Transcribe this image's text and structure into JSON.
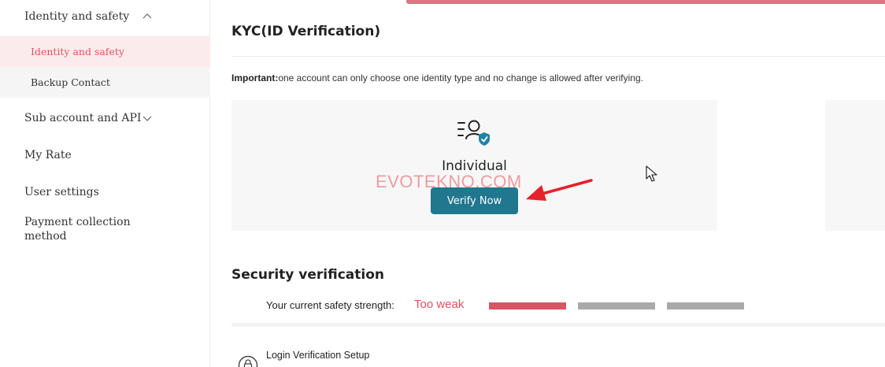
{
  "sidebar": {
    "group_identity": "Identity and safety",
    "sub_items": [
      "Identity and safety",
      "Backup Contact"
    ],
    "group_sub_account": "Sub account and API",
    "my_rate": "My Rate",
    "user_settings": "User settings",
    "payment_collection": "Payment collection method"
  },
  "kyc": {
    "title": "KYC(ID Verification)",
    "important_label": "Important:",
    "important_text": "one account can only choose one identity type and no change is allowed after verifying.",
    "card_label": "Individual",
    "verify_button": "Verify Now"
  },
  "watermark": "EVOTEKNO.COM",
  "security": {
    "title": "Security verification",
    "strength_label": "Your current safety strength:",
    "strength_value": "Too weak",
    "strength_bars": 3,
    "strength_filled": 1,
    "login_setup": "Login Verification Setup"
  },
  "colors": {
    "accent": "#e0525f",
    "button": "#21778e",
    "bar_filled": "#d95565",
    "bar_empty": "#a9a9a9",
    "annotation_arrow": "#e8202a"
  },
  "icons": [
    "chevron-up-icon",
    "chevron-down-icon",
    "id-verification-icon",
    "lock-icon",
    "red-arrow-annotation",
    "mouse-cursor-icon"
  ]
}
